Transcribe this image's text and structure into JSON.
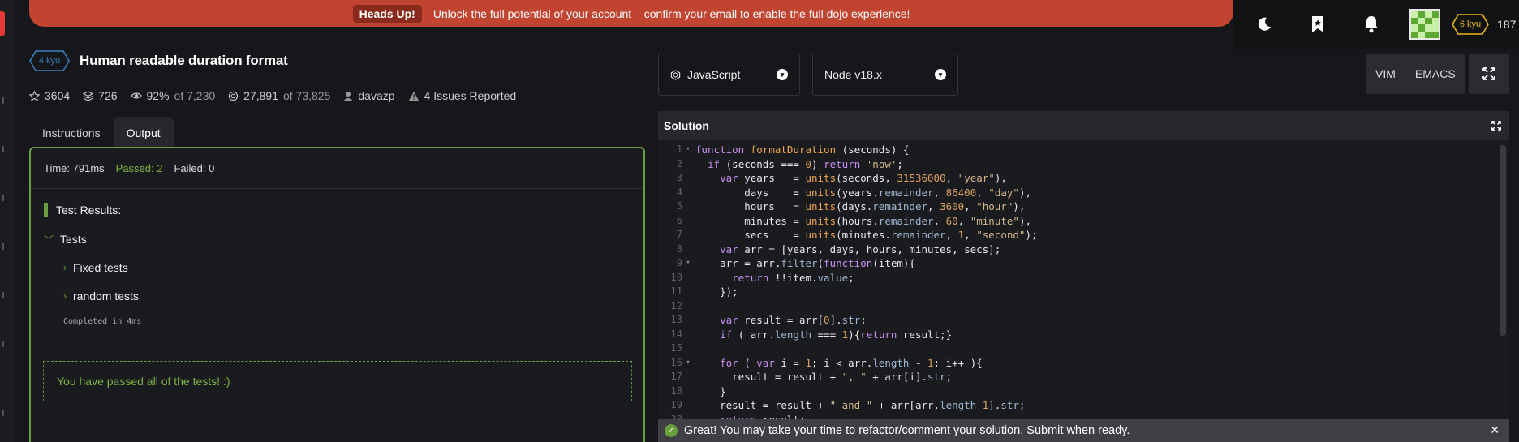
{
  "banner": {
    "badge": "Heads Up!",
    "message": "Unlock the full potential of your account – confirm your email to enable the full dojo experience!"
  },
  "user": {
    "rank": "6 kyu",
    "honor": "187",
    "icons": [
      "moon-icon",
      "bookmark-icon",
      "bell-icon"
    ]
  },
  "kata": {
    "rank": "4 kyu",
    "title": "Human readable duration format",
    "stars": "3604",
    "collections": "726",
    "satisfaction": "92%",
    "satisfaction_of": "of 7,230",
    "completed": "27,891",
    "completed_of": "of 73,825",
    "author": "davazp",
    "issues": "4 Issues Reported"
  },
  "tabs": [
    {
      "label": "Instructions",
      "active": false
    },
    {
      "label": "Output",
      "active": true
    }
  ],
  "output": {
    "time": "Time: 791ms",
    "passed": "Passed: 2",
    "failed": "Failed: 0",
    "results_title": "Test Results:",
    "root_node": "Tests",
    "children": [
      "Fixed tests",
      "random tests"
    ],
    "completed": "Completed in 4ms",
    "pass_message": "You have passed all of the tests! :)"
  },
  "editor": {
    "language": "JavaScript",
    "runtime": "Node v18.x",
    "modes": [
      "VIM",
      "EMACS"
    ],
    "solution_label": "Solution",
    "lines": [
      "function formatDuration (seconds) {",
      "  if (seconds === 0) return 'now';",
      "    var years   = units(seconds, 31536000, \"year\"),",
      "        days    = units(years.remainder, 86400, \"day\"),",
      "        hours   = units(days.remainder, 3600, \"hour\"),",
      "        minutes = units(hours.remainder, 60, \"minute\"),",
      "        secs    = units(minutes.remainder, 1, \"second\");",
      "    var arr = [years, days, hours, minutes, secs];",
      "    arr = arr.filter(function(item){",
      "      return !!item.value;",
      "    });",
      "",
      "    var result = arr[0].str;",
      "    if ( arr.length === 1){return result;}",
      "",
      "    for ( var i = 1; i < arr.length - 1; i++ ){",
      "      result = result + \", \" + arr[i].str;",
      "    }",
      "    result = result + \" and \" + arr[arr.length-1].str;",
      "    return result;"
    ],
    "fold_lines": [
      1,
      9,
      16
    ]
  },
  "toast": {
    "message": "Great! You may take your time to refactor/comment your solution. Submit when ready."
  }
}
